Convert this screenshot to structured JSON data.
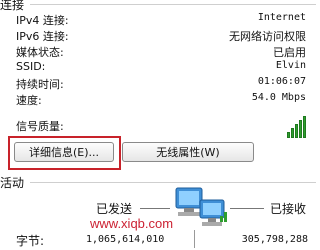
{
  "connection": {
    "title": "连接",
    "rows": [
      {
        "label": "IPv4 连接:",
        "value": "Internet",
        "mono": true
      },
      {
        "label": "IPv6 连接:",
        "value": "无网络访问权限",
        "mono": false
      },
      {
        "label": "媒体状态:",
        "value": "已启用",
        "mono": false
      },
      {
        "label": "SSID:",
        "value": "Elvin",
        "mono": true
      },
      {
        "label": "持续时间:",
        "value": "01:06:07",
        "mono": true
      },
      {
        "label": "速度:",
        "value": "54.0 Mbps",
        "mono": true
      }
    ],
    "signal_label": "信号质量:",
    "signal_level": 5
  },
  "buttons": {
    "details": "详细信息(E)...",
    "wireless": "无线属性(W)"
  },
  "activity": {
    "title": "活动",
    "sent_label": "已发送",
    "received_label": "已接收",
    "bytes_label": "字节:",
    "sent_bytes": "1,065,614,010",
    "received_bytes": "305,798,288"
  },
  "watermark": "www.xiqb.com"
}
